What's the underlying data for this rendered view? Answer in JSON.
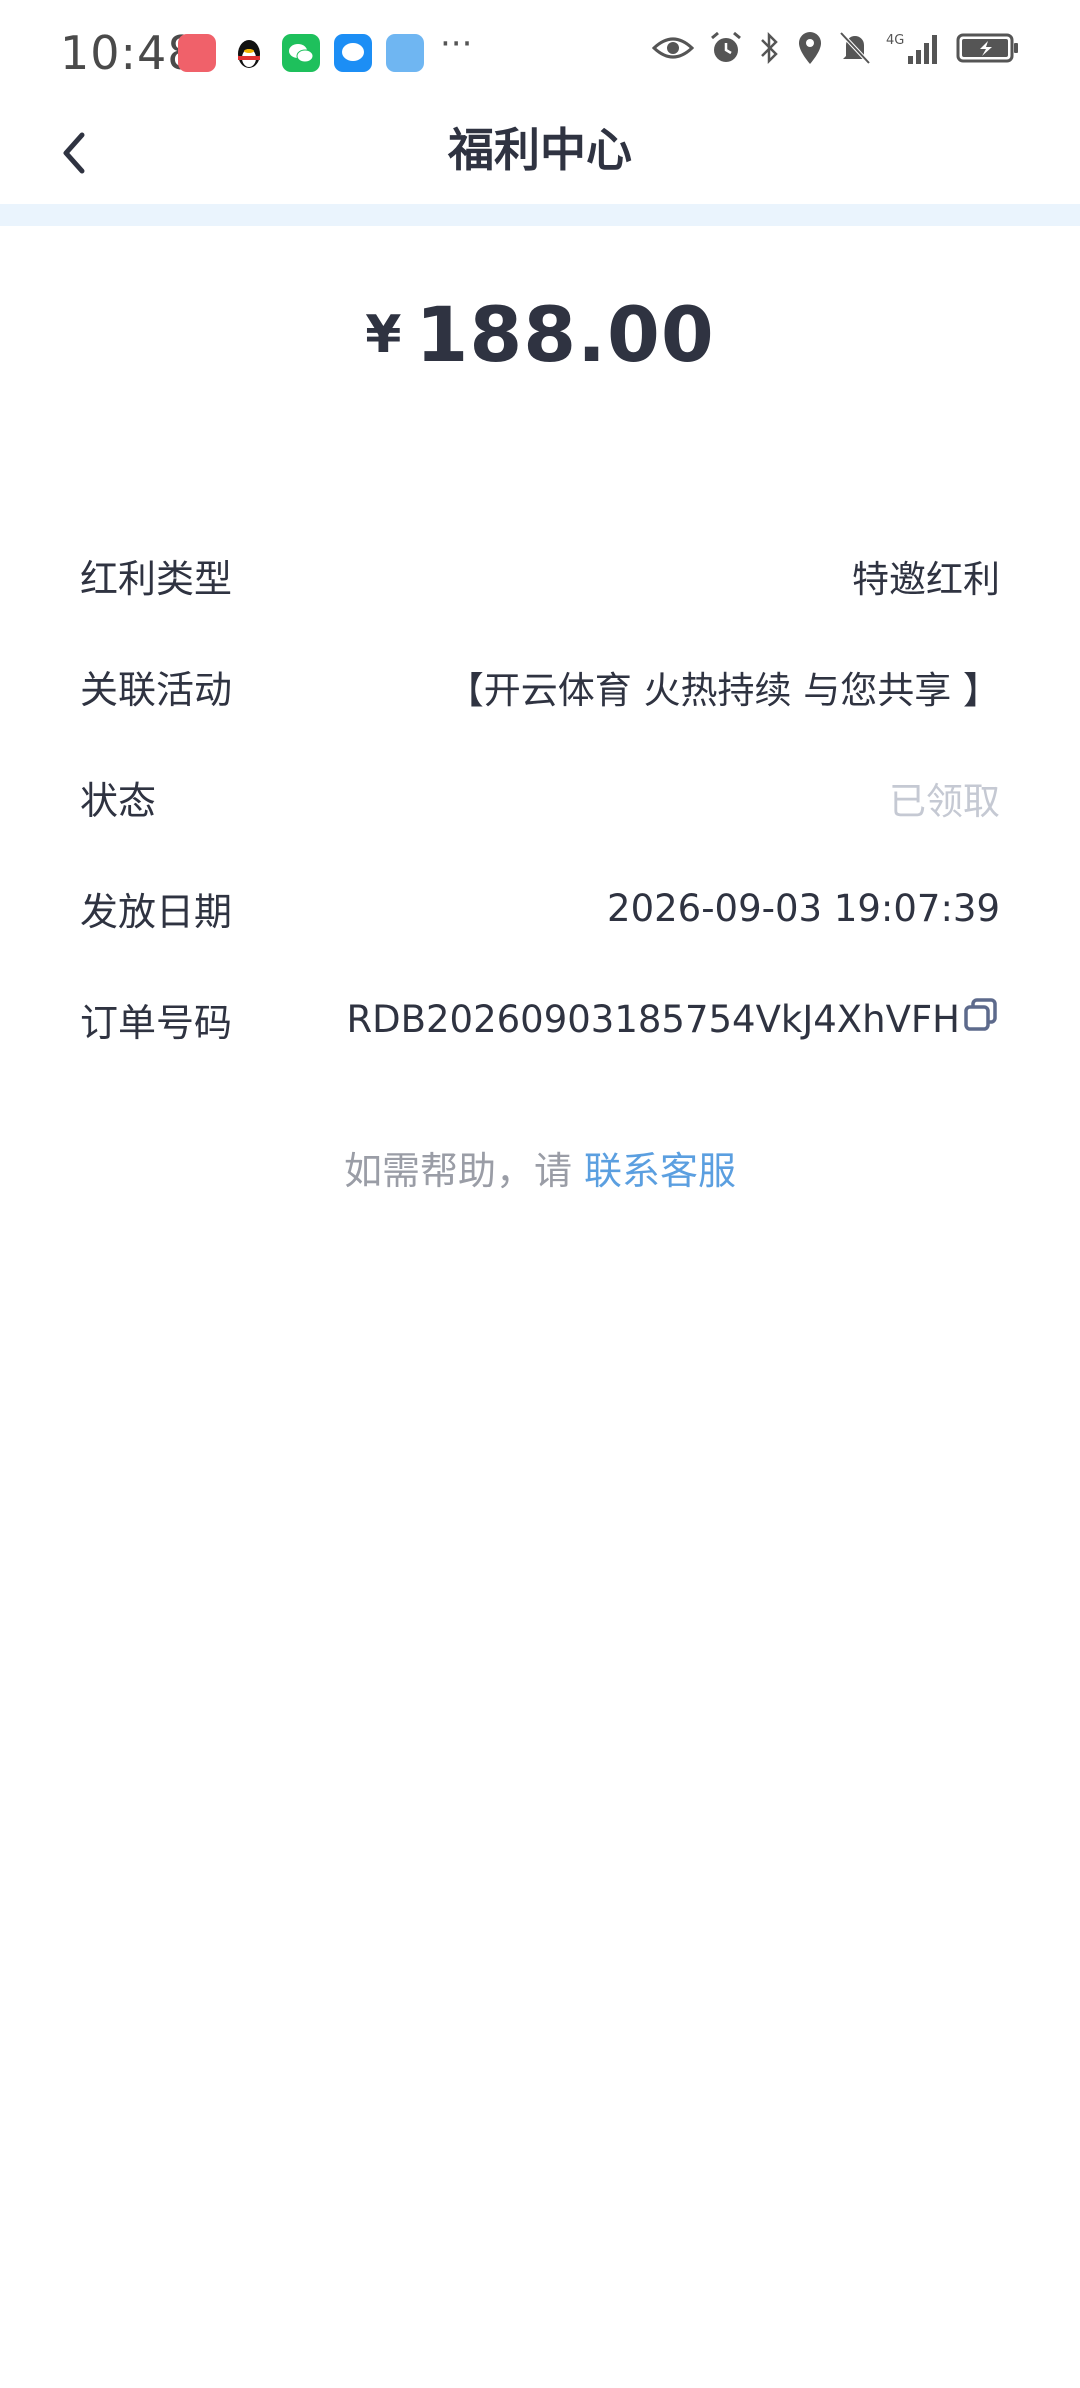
{
  "status_bar": {
    "time": "10:48",
    "more": "···",
    "apps": [
      {
        "icon": "app-store-icon",
        "color": "#f0616a"
      },
      {
        "icon": "qq-icon",
        "color": "#111111"
      },
      {
        "icon": "wechat-icon",
        "color": "#1ec05c"
      },
      {
        "icon": "messages-icon",
        "color": "#1c8ef5"
      },
      {
        "icon": "hongkong-app-icon",
        "color": "#6fb6f2"
      }
    ],
    "indicators": [
      "eye-icon",
      "alarm-icon",
      "bluetooth-icon",
      "location-icon",
      "mute-icon",
      "signal-icon",
      "battery-icon"
    ],
    "network": "4G"
  },
  "header": {
    "title": "福利中心"
  },
  "amount": {
    "currency": "¥",
    "value": "188.00"
  },
  "details": [
    {
      "label": "红利类型",
      "value": "特邀红利"
    },
    {
      "label": "关联活动",
      "value": "【开云体育 火热持续 与您共享 】"
    },
    {
      "label": "状态",
      "value": "已领取"
    },
    {
      "label": "发放日期",
      "value": "2026-09-03 19:07:39"
    },
    {
      "label": "订单号码",
      "value": "RDB20260903185754VkJ4XhVFH"
    }
  ],
  "help": {
    "prefix": "如需帮助，请",
    "link": "联系客服"
  },
  "colors": {
    "text": "#2f3341",
    "muted": "#c5c9d3",
    "link": "#5b9fe0",
    "band": "#eaf4fd"
  }
}
